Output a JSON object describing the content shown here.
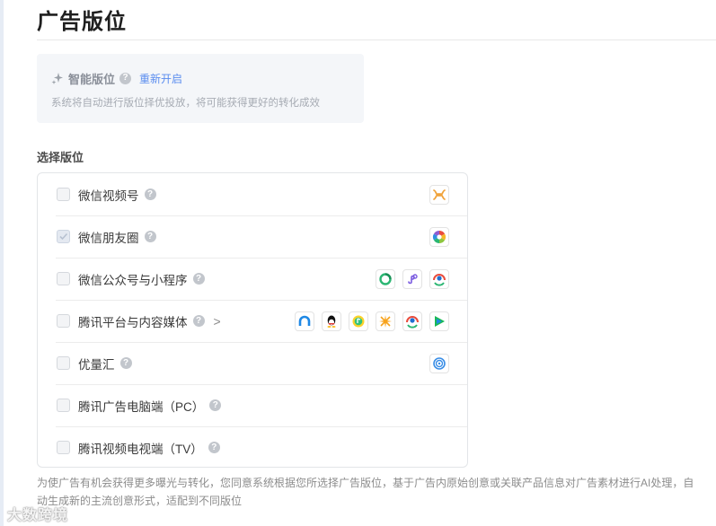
{
  "page": {
    "title": "广告版位"
  },
  "smart_placement": {
    "title": "智能版位",
    "reopen_link": "重新开启",
    "description": "系统将自动进行版位择优投放，将可能获得更好的转化成效"
  },
  "placement_section": {
    "label": "选择版位",
    "items": [
      {
        "label": "微信视频号",
        "checked": false,
        "help": "?",
        "icons": [
          "channels-icon"
        ]
      },
      {
        "label": "微信朋友圈",
        "checked": true,
        "help": "?",
        "icons": [
          "moments-icon"
        ]
      },
      {
        "label": "微信公众号与小程序",
        "checked": false,
        "help": "?",
        "icons": [
          "official-account-icon",
          "mini-program-icon",
          "wechat-search-icon"
        ]
      },
      {
        "label": "腾讯平台与内容媒体",
        "checked": false,
        "help": "?",
        "expand": ">",
        "icons": [
          "tencent-news-icon",
          "qq-icon",
          "qq-music-icon",
          "kuaibao-icon",
          "tencent-icon",
          "tencent-video-icon"
        ]
      },
      {
        "label": "优量汇",
        "checked": false,
        "help": "?",
        "icons": [
          "youlianghui-icon"
        ]
      },
      {
        "label": "腾讯广告电脑端（PC）",
        "checked": false,
        "help": "?",
        "icons": []
      },
      {
        "label": "腾讯视频电视端（TV）",
        "checked": false,
        "help": "?",
        "icons": []
      }
    ]
  },
  "bottom_note": "为使广告有机会获得更多曝光与转化，您同意系统根据您所选择广告版位，基于广告内原始创意或关联产品信息对广告素材进行AI处理，自动生成新的主流创意形式，适配到不同版位",
  "watermark": "大数跨境",
  "colors": {
    "accent": "#5b8def",
    "panel_bg": "#f4f6f9",
    "border": "#e3e5e8"
  }
}
